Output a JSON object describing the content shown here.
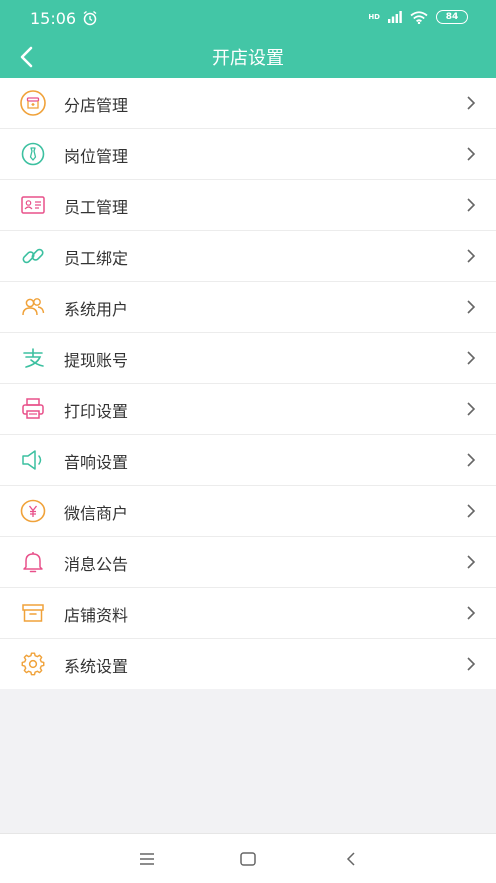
{
  "status_bar": {
    "time": "15:06",
    "network": "HD",
    "battery": "84"
  },
  "header": {
    "title": "开店设置"
  },
  "menu": [
    {
      "label": "分店管理",
      "icon": "store-icon",
      "color": "#f0a23a"
    },
    {
      "label": "岗位管理",
      "icon": "tie-icon",
      "color": "#3cc0a0"
    },
    {
      "label": "员工管理",
      "icon": "id-card-icon",
      "color": "#e8508a"
    },
    {
      "label": "员工绑定",
      "icon": "link-icon",
      "color": "#3cc0a0"
    },
    {
      "label": "系统用户",
      "icon": "users-icon",
      "color": "#f0a23a"
    },
    {
      "label": "提现账号",
      "icon": "alipay-icon",
      "color": "#3cc0a0"
    },
    {
      "label": "打印设置",
      "icon": "printer-icon",
      "color": "#e8508a"
    },
    {
      "label": "音响设置",
      "icon": "speaker-icon",
      "color": "#3cc0a0"
    },
    {
      "label": "微信商户",
      "icon": "yuan-coin-icon",
      "color": "#f0a23a"
    },
    {
      "label": "消息公告",
      "icon": "bell-icon",
      "color": "#e8508a"
    },
    {
      "label": "店铺资料",
      "icon": "shop-icon",
      "color": "#f0a23a"
    },
    {
      "label": "系统设置",
      "icon": "gear-icon",
      "color": "#f0a23a"
    }
  ],
  "accent_color": "#43c6a6"
}
